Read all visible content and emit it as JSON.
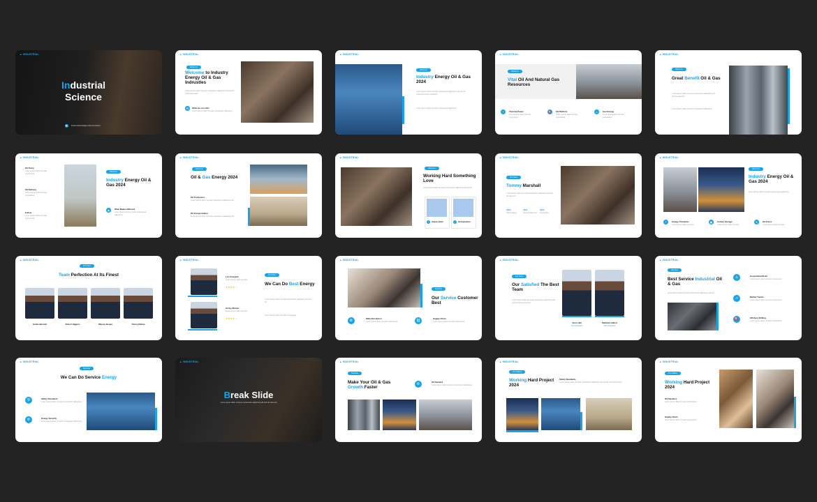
{
  "brand": "INDUSTRIAL",
  "accent_color": "#1aa3e8",
  "background_color": "#232323",
  "slides": {
    "s1": {
      "title_accent": "In",
      "title_rest": "dustrial",
      "title_line2": "Science",
      "tagline": "Future technologies and innovations"
    },
    "s2": {
      "pill": "About Us",
      "heading_accent": "Welcome",
      "heading_rest": " to Industry Energy Oil & Gas Indrustles",
      "sub": "What we can offer"
    },
    "s3": {
      "pill": "About Us",
      "heading_accent": "Industry",
      "heading_rest": " Energy Oil & Gas 2024"
    },
    "s4": {
      "pill": "About Us",
      "heading_accent": "Vital",
      "heading_rest": " Oil And Natural Gas Resources",
      "items": [
        "Thermal Power",
        "Oil Platform",
        "Gas Energy"
      ]
    },
    "s5": {
      "pill": "About Us",
      "heading_pre": "Great ",
      "heading_accent": "Benefit",
      "heading_rest": " Oil & Gas"
    },
    "s6": {
      "pill": "About Us",
      "heading_accent": "Industry",
      "heading_rest": " Energy Oil & Gas 2024",
      "items": [
        "Oil Pump",
        "Oil Refinery",
        "Follow"
      ],
      "sub": "What Makes Different"
    },
    "s7": {
      "pill": "About Us",
      "heading_pre": "Oil & ",
      "heading_accent": "Gas",
      "heading_rest": " Energy 2024",
      "items": [
        "Oil Production",
        "Oil Transportation"
      ]
    },
    "s8": {
      "pill": "About Us",
      "heading": "Working Hard Something Love",
      "items": [
        "Industry Work",
        "Oil Exploration"
      ]
    },
    "s9": {
      "pill": "Our Team",
      "heading_accent": "Tommy",
      "heading_rest": " Marshall",
      "stats": [
        "1865",
        "4521",
        "6352"
      ],
      "stat_labels": [
        "Client Happy",
        "Success Moment",
        "Completed"
      ]
    },
    "s10": {
      "pill": "About Us",
      "heading_accent": "Industry",
      "heading_rest": " Energy Oil & Gas 2024",
      "items": [
        "Energy Transition",
        "Carbon Storage",
        "Oil Prices"
      ]
    },
    "s11": {
      "pill": "Our Team",
      "heading_accent": "Team",
      "heading_rest": " Perfection At Its Finest",
      "people": [
        "Jackie Bennett",
        "Robert Higgins",
        "Wayne Jacque",
        "Timmy McGee"
      ]
    },
    "s12": {
      "pill": "Our Team",
      "heading_pre": "We Can Do ",
      "heading_accent": "Best",
      "heading_rest": " Energy",
      "people": [
        "Lori Vineyard",
        "Kenny Mundo"
      ]
    },
    "s13": {
      "pill": "Services",
      "heading_pre": "Our ",
      "heading_accent": "Service",
      "heading_rest": " Customer Best",
      "items": [
        "Wide Revolution",
        "Supply Chain"
      ]
    },
    "s14": {
      "pill": "Our Team",
      "heading_pre": "Our ",
      "heading_accent": "Satisfied",
      "heading_rest": " The Best Team",
      "people": [
        "Chris Hall",
        "Matthew Gilbert"
      ],
      "roles": [
        "Vice President",
        "Vice President"
      ]
    },
    "s15": {
      "pill": "Services",
      "heading_pre": "Best Service ",
      "heading_accent": "Industrial",
      "heading_rest": " Oil & Gas",
      "items": [
        "Geopolitical Risks",
        "Market Trends",
        "Offshore Drilling"
      ]
    },
    "s16": {
      "pill": "Services",
      "heading_pre": "We Can Do Service ",
      "heading_accent": "Energy",
      "items": [
        "Safety Standards",
        "Energy Security"
      ]
    },
    "s17": {
      "heading_accent": "B",
      "heading_rest": "reak Slide"
    },
    "s18": {
      "pill": "Services",
      "heading_pre": "Make Your Oil & Gas ",
      "heading_accent": "Growth",
      "heading_rest": " Faster",
      "item": "Oil Demand"
    },
    "s19": {
      "pill": "Our Gallery",
      "heading_accent": "Working",
      "heading_rest": " Hard Project 2024",
      "item": "Safety Standards"
    },
    "s20": {
      "pill": "Our Gallery",
      "heading_accent": "Working",
      "heading_rest": " Hard Project 2024",
      "items": [
        "Oil Pipelines",
        "Supply Chain"
      ]
    }
  }
}
